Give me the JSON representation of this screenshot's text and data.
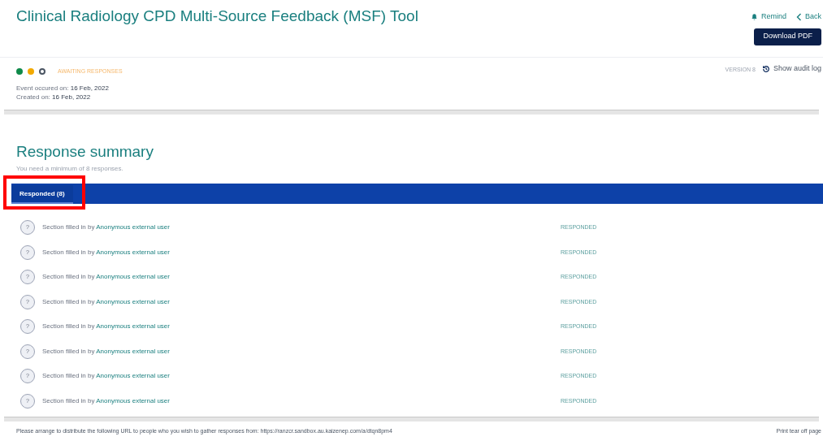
{
  "header": {
    "title": "Clinical Radiology CPD Multi-Source Feedback (MSF) Tool",
    "remind": "Remind",
    "back": "Back",
    "download": "Download PDF"
  },
  "status": {
    "steps": [
      {
        "kind": "filled",
        "color": "#0f8a4a"
      },
      {
        "kind": "filled",
        "color": "#f2a900"
      },
      {
        "kind": "outline",
        "color": "#4b5563"
      }
    ],
    "label": "AWAITING RESPONSES",
    "event_label": "Event occured on:",
    "event_date": "16 Feb, 2022",
    "created_label": "Created on:",
    "created_date": "16 Feb, 2022",
    "version": "VERSION 8",
    "audit": "Show audit log"
  },
  "summary": {
    "title": "Response summary",
    "note": "You need a minimum of 8 responses.",
    "tabs": [
      {
        "label": "Responded (8)",
        "selected": true,
        "highlighted": true
      }
    ],
    "rows": [
      {
        "icon": "?",
        "text": "Section filled in by",
        "user": "Anonymous external user",
        "status": "RESPONDED"
      },
      {
        "icon": "?",
        "text": "Section filled in by",
        "user": "Anonymous external user",
        "status": "RESPONDED"
      },
      {
        "icon": "?",
        "text": "Section filled in by",
        "user": "Anonymous external user",
        "status": "RESPONDED"
      },
      {
        "icon": "?",
        "text": "Section filled in by",
        "user": "Anonymous external user",
        "status": "RESPONDED"
      },
      {
        "icon": "?",
        "text": "Section filled in by",
        "user": "Anonymous external user",
        "status": "RESPONDED"
      },
      {
        "icon": "?",
        "text": "Section filled in by",
        "user": "Anonymous external user",
        "status": "RESPONDED"
      },
      {
        "icon": "?",
        "text": "Section filled in by",
        "user": "Anonymous external user",
        "status": "RESPONDED"
      },
      {
        "icon": "?",
        "text": "Section filled in by",
        "user": "Anonymous external user",
        "status": "RESPONDED"
      }
    ]
  },
  "footer": {
    "text": "Please arrange to distribute the following URL to people who you wish to gather responses from: https://ranzcr.sandbox.au.kaizenep.com/a/dtqn8pm4",
    "print": "Print tear off page"
  }
}
